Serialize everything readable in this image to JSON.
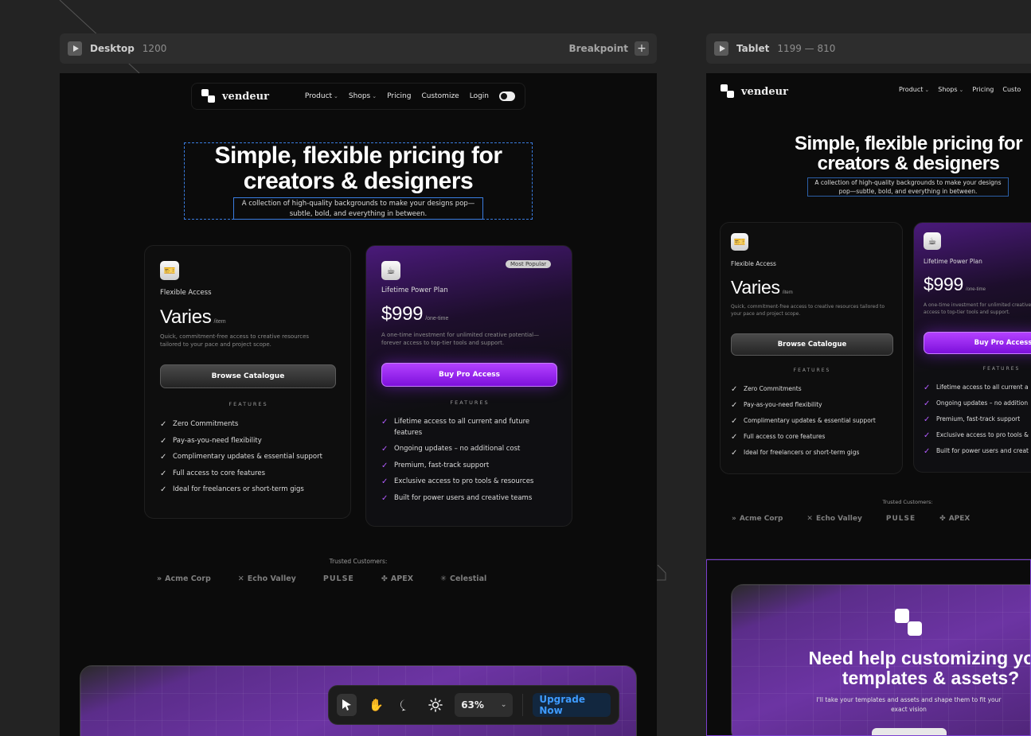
{
  "frames": {
    "desktop": {
      "name": "Desktop",
      "size": "1200",
      "breakpoint_label": "Breakpoint"
    },
    "tablet": {
      "name": "Tablet",
      "size": "1199 — 810"
    }
  },
  "nav": {
    "brand": "vendeur",
    "links": [
      "Product",
      "Shops",
      "Pricing",
      "Customize",
      "Login"
    ]
  },
  "hero": {
    "title_line1": "Simple, flexible pricing for",
    "title_line2": "creators & designers",
    "subtitle_line1": "A collection of high-quality backgrounds to make your designs pop—",
    "subtitle_line2": "subtle, bold, and everything in between."
  },
  "plans": [
    {
      "name": "Flexible Access",
      "price": "Varies",
      "unit": "/item",
      "desc_line1": "Quick, commitment-free access to creative resources",
      "desc_line2": "tailored to your pace and project scope.",
      "button": "Browse Catalogue",
      "features_label": "FEATURES",
      "features": [
        "Zero Commitments",
        "Pay-as-you-need flexibility",
        "Complimentary updates & essential support",
        "Full access to core features",
        "Ideal for freelancers or short-term gigs"
      ]
    },
    {
      "name": "Lifetime Power Plan",
      "badge": "Most Popular",
      "price": "$999",
      "unit": "/one-time",
      "desc_line1": "A one-time investment for unlimited creative potential—",
      "desc_line2": "forever access to top-tier tools and support.",
      "button": "Buy Pro Access",
      "features_label": "FEATURES",
      "features": [
        "Lifetime access to all current and future features",
        "Ongoing updates – no additional cost",
        "Premium, fast-track support",
        "Exclusive access to pro tools & resources",
        "Built for power users and creative teams"
      ]
    }
  ],
  "trusted": {
    "label": "Trusted Customers:",
    "logos": [
      "Acme Corp",
      "Echo Valley",
      "PULSE",
      "APEX",
      "Celestial"
    ]
  },
  "tablet": {
    "hero_title_line1": "Simple, flexible pricing for",
    "hero_title_line2": "creators & designers",
    "hero_sub_line1": "A collection of high-quality backgrounds to make your designs",
    "hero_sub_line2": "pop—subtle, bold, and everything in between.",
    "nav_links": [
      "Product",
      "Shops",
      "Pricing",
      "Custo"
    ],
    "plan1_desc_line1": "Quick, commitment-free access to creative resources tailored to",
    "plan1_desc_line2": "your pace and project scope.",
    "plan2_desc_line1": "A one-time investment for unlimited creative",
    "plan2_desc_line2": "access to top-tier tools and support.",
    "plan2_features": [
      "Lifetime access to all current a",
      "Ongoing updates – no addition",
      "Premium, fast-track support",
      "Exclusive access to pro tools &",
      "Built for power users and creat"
    ],
    "plan2_button": "Buy Pro Access",
    "logos": [
      "Acme Corp",
      "Echo Valley",
      "PULSE",
      "APEX"
    ],
    "cta_title_line1": "Need help customizing your",
    "cta_title_line2": "templates & assets?",
    "cta_sub_line1": "I'll take your templates and assets and shape them to fit your",
    "cta_sub_line2": "exact vision"
  },
  "toolbar": {
    "zoom": "63%",
    "upgrade": "Upgrade Now",
    "tools": [
      "cursor-icon",
      "hand-icon",
      "comment-icon",
      "sun-icon"
    ]
  },
  "colors": {
    "accent": "#9b2cff",
    "canvas": "#0b0b0b",
    "workspace": "#232323",
    "upgrade_text": "#3e9bff"
  }
}
